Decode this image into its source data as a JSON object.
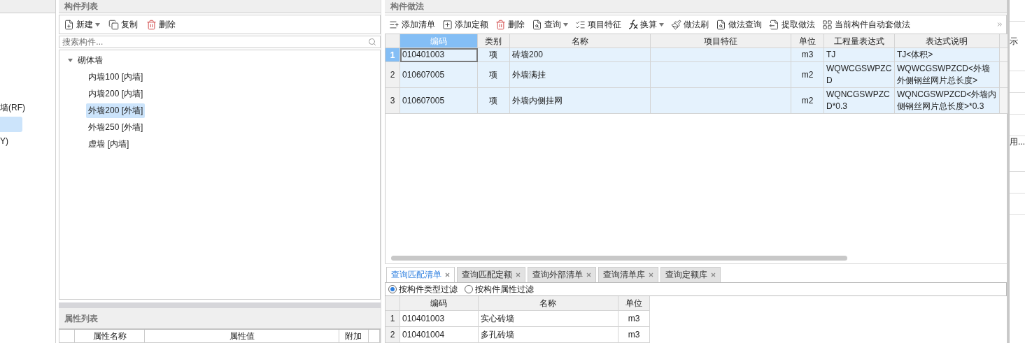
{
  "left_panel": {
    "items": [
      {
        "label": "墙(RF)",
        "selected": false
      },
      {
        "selected": true
      },
      {
        "label": "Y)",
        "selected": false
      }
    ]
  },
  "component_list": {
    "title": "构件列表",
    "toolbar": [
      {
        "label": "新建",
        "dropdown": true
      },
      {
        "label": "复制",
        "dropdown": false
      },
      {
        "label": "删除",
        "dropdown": false
      }
    ],
    "search": {
      "placeholder": "搜索构件..."
    },
    "tree": [
      {
        "label": "砌体墙",
        "expanded": true,
        "children": [
          {
            "label": "内墙100 [内墙]",
            "selected": false
          },
          {
            "label": "内墙200 [内墙]",
            "selected": false
          },
          {
            "label": "外墙200 [外墙]",
            "selected": true
          },
          {
            "label": "外墙250 [外墙]",
            "selected": false
          },
          {
            "label": "虚墙 [内墙]",
            "selected": false
          }
        ]
      }
    ]
  },
  "property_list": {
    "title": "属性列表",
    "columns": [
      "属性名称",
      "属性值",
      "附加"
    ]
  },
  "component_methods": {
    "title": "构件做法",
    "toolbar": [
      {
        "label": "添加清单",
        "dropdown": false
      },
      {
        "label": "添加定额",
        "dropdown": false
      },
      {
        "label": "删除",
        "dropdown": false
      },
      {
        "label": "查询",
        "dropdown": true
      },
      {
        "label": "项目特征",
        "dropdown": false
      },
      {
        "label": "换算",
        "dropdown": true
      },
      {
        "label": "做法刷",
        "dropdown": false
      },
      {
        "label": "做法查询",
        "dropdown": false
      },
      {
        "label": "提取做法",
        "dropdown": false
      },
      {
        "label": "当前构件自动套做法",
        "dropdown": false
      }
    ],
    "columns": [
      "编码",
      "类别",
      "名称",
      "项目特征",
      "单位",
      "工程量表达式",
      "表达式说明"
    ],
    "rows": [
      {
        "index": "1",
        "selected": true,
        "cells": [
          "010401003",
          "项",
          "砖墙200",
          "",
          "m3",
          "TJ",
          "TJ<体积>"
        ]
      },
      {
        "index": "2",
        "selected": false,
        "cells": [
          "010607005",
          "项",
          "外墙满挂",
          "",
          "m2",
          "WQWCGSWPZCD",
          "WQWCGSWPZCD<外墙外侧钢丝网片总长度>"
        ]
      },
      {
        "index": "3",
        "selected": false,
        "cells": [
          "010607005",
          "项",
          "外墙内侧挂网",
          "",
          "m2",
          "WQNCGSWPZCD*0.3",
          "WQNCGSWPZCD<外墙内侧钢丝网片总长度>*0.3"
        ]
      }
    ]
  },
  "query_tabs": [
    {
      "label": "查询匹配清单",
      "selected": true
    },
    {
      "label": "查询匹配定额",
      "selected": false
    },
    {
      "label": "查询外部清单",
      "selected": false
    },
    {
      "label": "查询清单库",
      "selected": false
    },
    {
      "label": "查询定额库",
      "selected": false
    }
  ],
  "filters": [
    {
      "label": "按构件类型过滤",
      "selected": true
    },
    {
      "label": "按构件属性过滤",
      "selected": false
    }
  ],
  "query_table": {
    "columns": [
      "编码",
      "名称",
      "单位"
    ],
    "rows": [
      {
        "index": "1",
        "cells": [
          "010401003",
          "实心砖墙",
          "m3"
        ]
      },
      {
        "index": "2",
        "cells": [
          "010401004",
          "多孔砖墙",
          "m3"
        ]
      }
    ]
  },
  "right_edge": {
    "texts": [
      "示",
      "用..."
    ]
  }
}
